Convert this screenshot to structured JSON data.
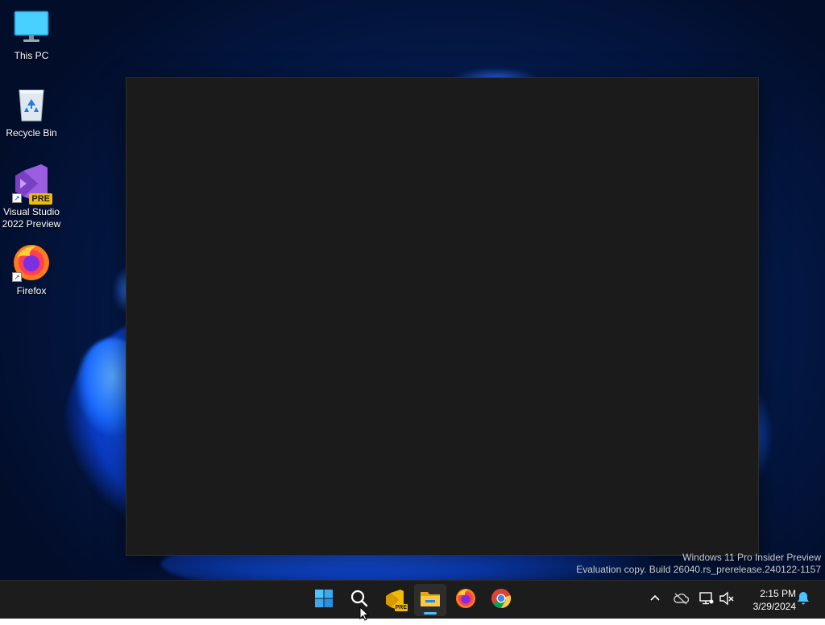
{
  "desktop": {
    "icons": [
      {
        "label": "This PC",
        "icon": "monitor-icon"
      },
      {
        "label": "Recycle Bin",
        "icon": "recycle-bin-icon"
      },
      {
        "label_line1": "Visual Studio",
        "label_line2": "2022 Preview",
        "icon": "visual-studio-preview-icon",
        "badge": "PRE"
      },
      {
        "label": "Firefox",
        "icon": "firefox-icon"
      }
    ]
  },
  "watermark": {
    "line1": "Windows 11 Pro Insider Preview",
    "line2": "Evaluation copy. Build 26040.rs_prerelease.240122-1157"
  },
  "taskbar": {
    "pinned": [
      {
        "name": "start",
        "icon": "windows-logo-icon"
      },
      {
        "name": "search",
        "icon": "search-icon"
      },
      {
        "name": "visual-studio-preview",
        "icon": "visual-studio-preview-icon",
        "badge": "PRE"
      },
      {
        "name": "file-explorer",
        "icon": "folder-icon",
        "active": true
      },
      {
        "name": "firefox",
        "icon": "firefox-icon"
      },
      {
        "name": "chrome",
        "icon": "chrome-icon"
      }
    ],
    "tray": {
      "icons": [
        "chevron-up-icon",
        "onedrive-offline-icon",
        "network-icon",
        "volume-muted-icon",
        "notification-bell-icon"
      ],
      "time": "2:15 PM",
      "date": "3/29/2024"
    }
  },
  "colors": {
    "taskbar_bg": "#1c1c1c",
    "window_bg": "#1b1b1b",
    "accent": "#4cc2ff",
    "wallpaper_blue": "#0a5bff"
  }
}
